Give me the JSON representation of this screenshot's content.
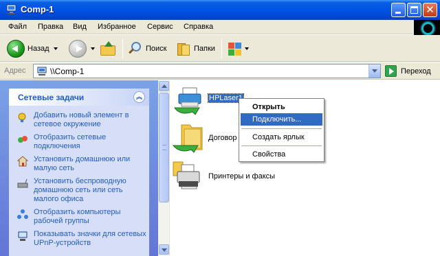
{
  "window": {
    "title": "Comp-1"
  },
  "menu": {
    "items": [
      {
        "label": "Файл"
      },
      {
        "label": "Правка"
      },
      {
        "label": "Вид"
      },
      {
        "label": "Избранное"
      },
      {
        "label": "Сервис"
      },
      {
        "label": "Справка"
      }
    ]
  },
  "toolbar": {
    "back_label": "Назад",
    "search_label": "Поиск",
    "folders_label": "Папки"
  },
  "address": {
    "label": "Адрес",
    "value": "\\\\Comp-1",
    "go_label": "Переход"
  },
  "taskpane": {
    "title": "Сетевые задачи",
    "items": [
      {
        "label": "Добавить новый элемент в сетевое окружение",
        "icon": "add-network-place-icon"
      },
      {
        "label": "Отобразить сетевые подключения",
        "icon": "network-connections-icon"
      },
      {
        "label": "Установить домашнюю или малую сеть",
        "icon": "home-network-icon"
      },
      {
        "label": "Установить беспроводную домашнюю сеть или сеть малого офиса",
        "icon": "wireless-network-icon"
      },
      {
        "label": "Отобразить компьютеры рабочей группы",
        "icon": "workgroup-computers-icon"
      },
      {
        "label": "Показывать значки для сетевых UPnP-устройств",
        "icon": "upnp-devices-icon"
      }
    ]
  },
  "content": {
    "items": [
      {
        "label": "HPLaser1",
        "icon": "shared-printer-icon",
        "selected": true
      },
      {
        "label": "Договор",
        "icon": "shared-folder-icon",
        "selected": false
      },
      {
        "label": "Принтеры и факсы",
        "icon": "printers-faxes-icon",
        "selected": false
      }
    ]
  },
  "context_menu": {
    "items": [
      {
        "label": "Открыть"
      },
      {
        "label": "Подключить..."
      },
      {
        "label": "Создать ярлык"
      },
      {
        "label": "Свойства"
      }
    ]
  },
  "colors": {
    "title_bar": "#0055e5",
    "task_link": "#215dc6",
    "selection": "#316ac5"
  }
}
